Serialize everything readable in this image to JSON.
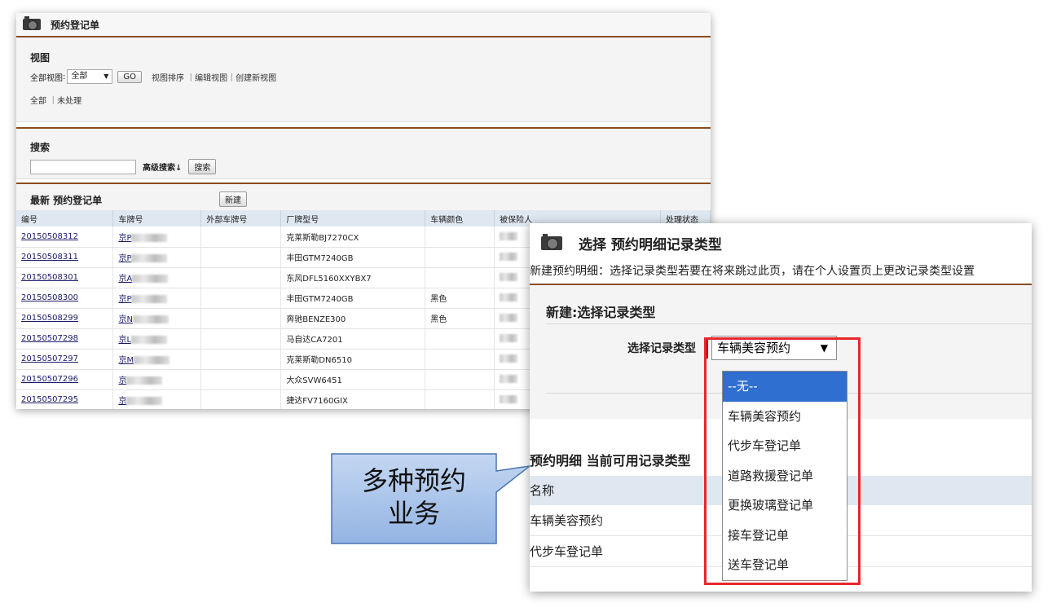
{
  "list_window": {
    "title": "预约登记单",
    "view": {
      "heading": "视图",
      "label": "全部视图",
      "colon": ":",
      "selected": "全部",
      "go": "GO",
      "links": "视图排序 ｜编辑视图｜创建新视图",
      "filters": "全部 ｜未处理"
    },
    "search": {
      "heading": "搜索",
      "advanced": "高级搜索↓",
      "button": "搜索"
    },
    "recent": {
      "title": "最新 预约登记单",
      "new_button": "新建",
      "columns": [
        "编号",
        "车牌号",
        "外部车牌号",
        "厂牌型号",
        "车辆颜色",
        "被保险人",
        "处理状态"
      ],
      "rows": [
        {
          "id": "20150508312",
          "plate": "京P",
          "model": "克莱斯勒BJ7270CX",
          "color": ""
        },
        {
          "id": "20150508311",
          "plate": "京P",
          "model": "丰田GTM7240GB",
          "color": ""
        },
        {
          "id": "20150508301",
          "plate": "京A",
          "model": "东风DFL5160XXYBX7",
          "color": ""
        },
        {
          "id": "20150508300",
          "plate": "京P",
          "model": "丰田GTM7240GB",
          "color": "黑色"
        },
        {
          "id": "20150508299",
          "plate": "京N",
          "model": "奔驰BENZE300",
          "color": "黑色"
        },
        {
          "id": "20150507298",
          "plate": "京L",
          "model": "马自达CA7201",
          "color": ""
        },
        {
          "id": "20150507297",
          "plate": "京M",
          "model": "克莱斯勒DN6510",
          "color": ""
        },
        {
          "id": "20150507296",
          "plate": "京",
          "model": "大众SVW6451",
          "color": ""
        },
        {
          "id": "20150507295",
          "plate": "京",
          "model": "捷达FV7160GIX",
          "color": ""
        }
      ]
    }
  },
  "record_type_window": {
    "title": "选择 预约明细记录类型",
    "description": "新建预约明细：选择记录类型若要在将来跳过此页，请在个人设置页上更改记录类型设置",
    "subtitle": "新建:选择记录类型",
    "field_label": "选择记录类型",
    "selected_value": "车辆美容预约",
    "options": [
      "--无--",
      "车辆美容预约",
      "代步车登记单",
      "道路救援登记单",
      "更换玻璃登记单",
      "接车登记单",
      "送车登记单"
    ],
    "available_title": "预约明细 当前可用记录类型",
    "available_header": "名称",
    "available_rows": [
      "车辆美容预约",
      "代步车登记单"
    ]
  },
  "callout": {
    "line1": "多种预约",
    "line2": "业务"
  },
  "colors": {
    "accent_rule": "#8a4d1f",
    "highlight_box": "#e8262b",
    "selected_option": "#2f6fd0",
    "callout_fill": "#a8c4ea"
  }
}
